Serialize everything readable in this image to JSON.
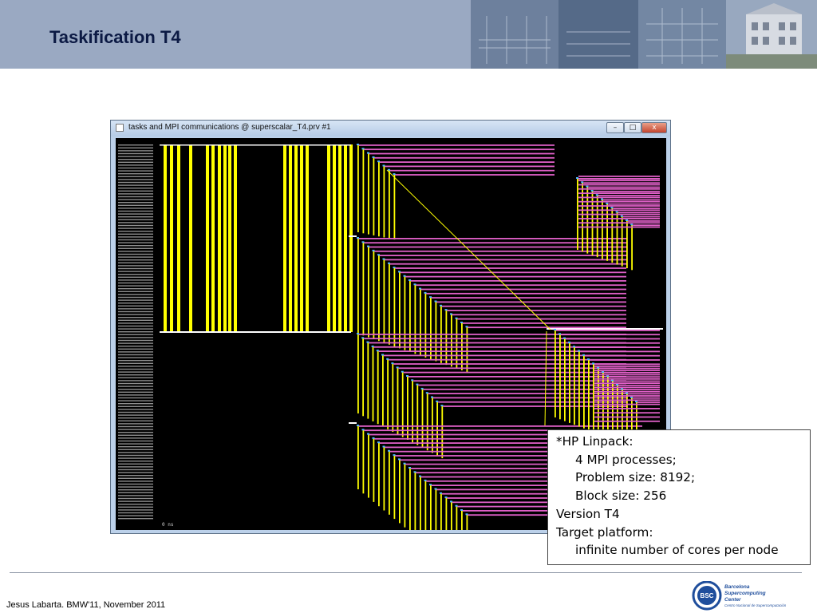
{
  "slide": {
    "title": "Taskification T4",
    "footer": "Jesus Labarta. BMW'11, November 2011"
  },
  "window": {
    "title": "tasks and MPI communications @ superscalar_T4.prv #1",
    "min_glyph": "–",
    "max_glyph": "□",
    "close_glyph": "x",
    "time_start": "0 ns"
  },
  "note": {
    "lines": [
      "*HP Linpack:",
      "4 MPI processes;",
      "Problem size: 8192;",
      "Block size: 256",
      "Version T4",
      "Target platform:",
      "infinite number of cores per node"
    ]
  },
  "logo": {
    "abbr": "BSC",
    "line1": "Barcelona",
    "line2": "Supercomputing",
    "line3": "Center",
    "line4": "Centro Nacional de Supercomputación"
  },
  "colors": {
    "header": "#9aa9c2",
    "title": "#0c1a44",
    "task": "#ffff00",
    "mpi": "#e060c8",
    "trace_bg": "#000000",
    "logo_blue": "#1f4e9c"
  }
}
